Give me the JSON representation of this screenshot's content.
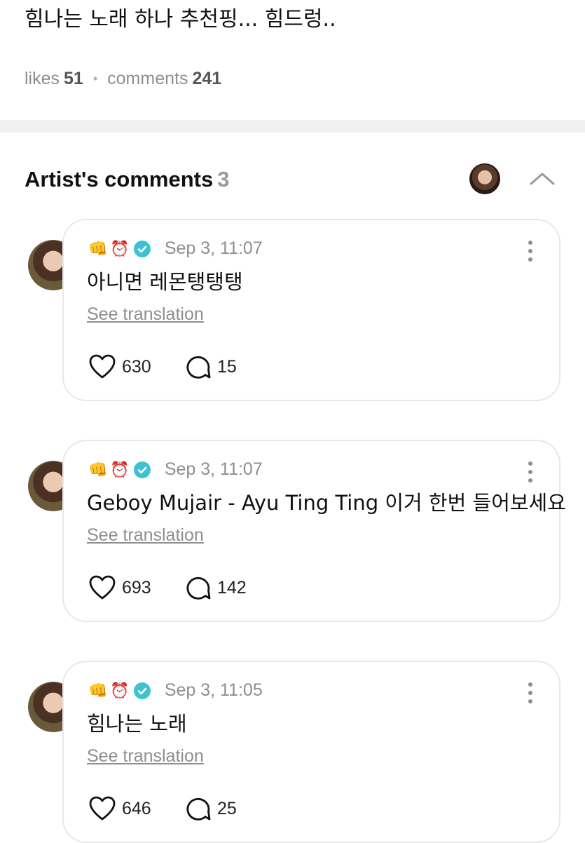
{
  "post": {
    "title": "힘나는 노래 하나 추천핑... 힘드렁..",
    "likes_label": "likes",
    "likes": "51",
    "comments_label": "comments",
    "comments": "241"
  },
  "section": {
    "title": "Artist's comments",
    "count": "3"
  },
  "comments": [
    {
      "badges": [
        "👊",
        "⏰"
      ],
      "time": "Sep 3, 11:07",
      "text": "아니면 레몬탱탱탱",
      "translate": "See translation",
      "likes": "630",
      "replies": "15"
    },
    {
      "badges": [
        "👊",
        "⏰"
      ],
      "time": "Sep 3, 11:07",
      "text": "Geboy Mujair - Ayu Ting Ting 이거 한번 들어보세요",
      "translate": "See translation",
      "likes": "693",
      "replies": "142"
    },
    {
      "badges": [
        "👊",
        "⏰"
      ],
      "time": "Sep 3, 11:05",
      "text": "힘나는 노래",
      "translate": "See translation",
      "likes": "646",
      "replies": "25"
    }
  ],
  "icons": {
    "verified": "verified-check-icon",
    "like": "heart-icon",
    "reply": "speech-bubble-icon",
    "more": "more-vertical-icon",
    "collapse": "chevron-up-icon"
  },
  "colors": {
    "verified": "#3ec1d3",
    "muted_text": "#8e8e93",
    "card_border": "#e8e8ea"
  }
}
